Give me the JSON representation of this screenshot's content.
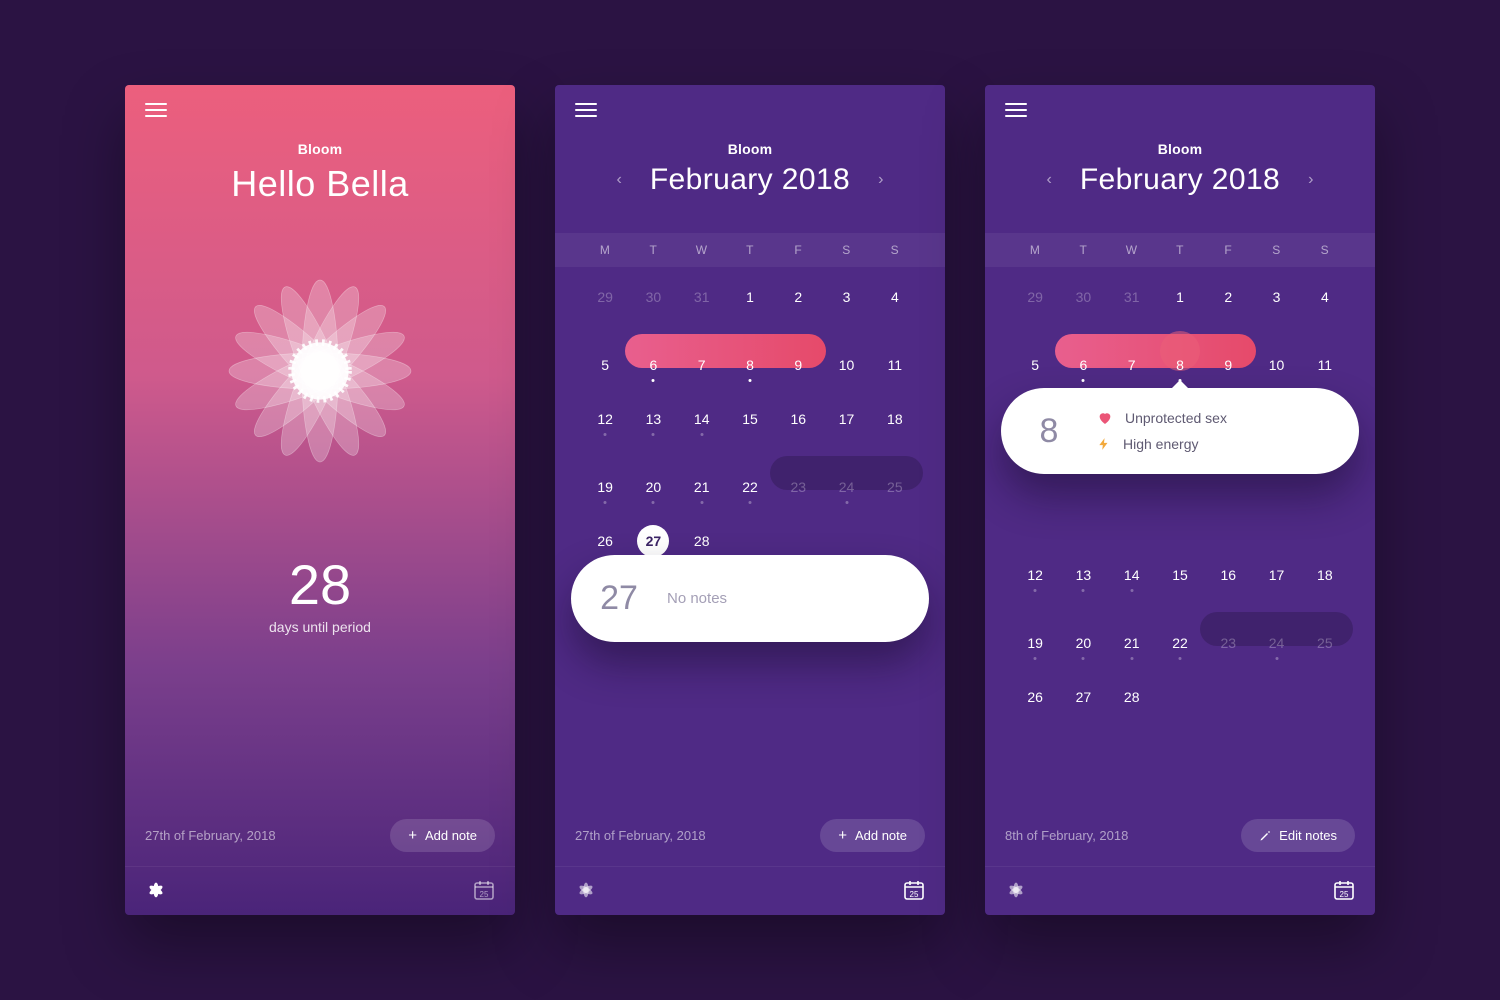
{
  "app_name": "Bloom",
  "home": {
    "greeting": "Hello Bella",
    "countdown_number": "28",
    "countdown_label": "days until period",
    "footer_date": "27th of February, 2018",
    "add_note_label": "Add note",
    "calendar_badge": "25"
  },
  "screen2": {
    "month_title": "February 2018",
    "dow": [
      "M",
      "T",
      "W",
      "T",
      "F",
      "S",
      "S"
    ],
    "prev_trail": [
      "29",
      "30",
      "31"
    ],
    "days": [
      "1",
      "2",
      "3",
      "4",
      "5",
      "6",
      "7",
      "8",
      "9",
      "10",
      "11",
      "12",
      "13",
      "14",
      "15",
      "16",
      "17",
      "18",
      "19",
      "20",
      "21",
      "22",
      "23",
      "24",
      "25",
      "26",
      "27",
      "28"
    ],
    "period_range_labels": [
      "6",
      "7",
      "8",
      "9"
    ],
    "selected_day": "27",
    "dim_range_start": "23",
    "note_card_day": "27",
    "note_card_text": "No notes",
    "footer_date": "27th of February, 2018",
    "add_note_label": "Add note",
    "calendar_badge": "25"
  },
  "screen3": {
    "month_title": "February 2018",
    "dow": [
      "M",
      "T",
      "W",
      "T",
      "F",
      "S",
      "S"
    ],
    "prev_trail": [
      "29",
      "30",
      "31"
    ],
    "selected_day": "8",
    "note_card_day": "8",
    "notes": [
      {
        "icon": "heart",
        "label": "Unprotected sex"
      },
      {
        "icon": "bolt",
        "label": "High energy"
      }
    ],
    "footer_date": "8th of February, 2018",
    "edit_notes_label": "Edit notes",
    "calendar_badge": "25"
  }
}
